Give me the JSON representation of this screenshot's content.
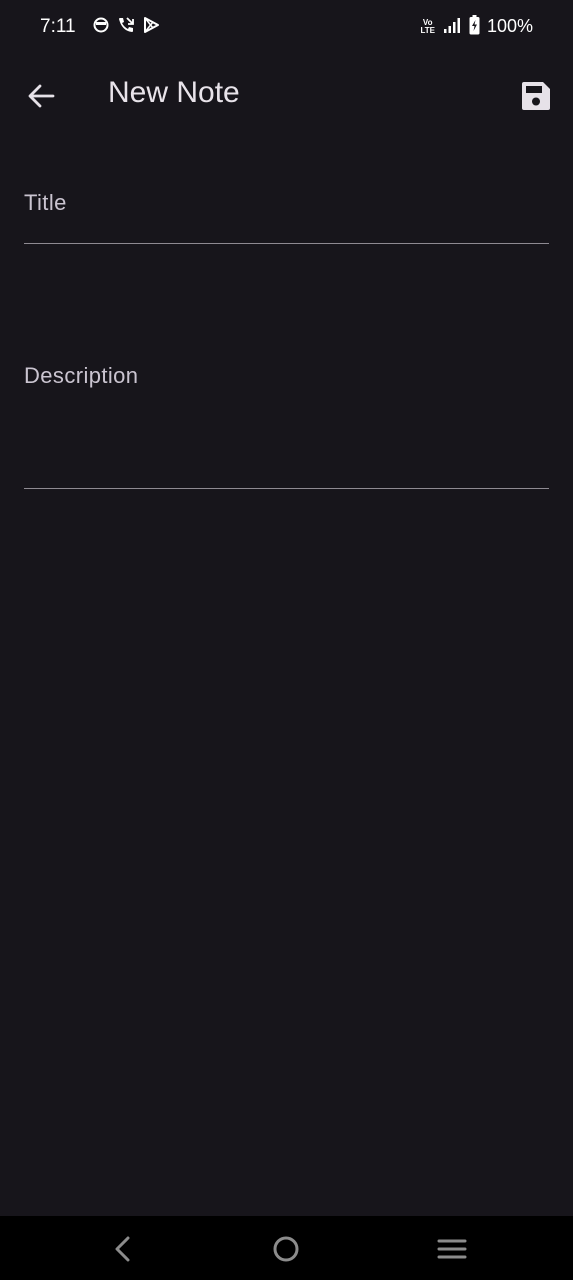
{
  "status_bar": {
    "time": "7:11",
    "battery": "100%",
    "network_badge_top": "Vo",
    "network_badge_bottom": "LTE",
    "left_icons": [
      "notification-ring-icon",
      "missed-call-icon",
      "play-store-icon"
    ],
    "right_icons": [
      "volte-icon",
      "signal-icon",
      "battery-charging-icon"
    ]
  },
  "app_bar": {
    "title": "New Note",
    "back_icon": "arrow-back-icon",
    "save_icon": "save-icon"
  },
  "form": {
    "title_label": "Title",
    "description_label": "Description"
  },
  "nav_bar": {
    "icons": [
      "nav-back-icon",
      "nav-home-icon",
      "nav-recents-icon"
    ]
  },
  "colors": {
    "background": "#17151b",
    "text": "#e6e1e8",
    "label": "#cac4d0",
    "underline": "#8e8a92",
    "nav_bar": "#000000"
  }
}
